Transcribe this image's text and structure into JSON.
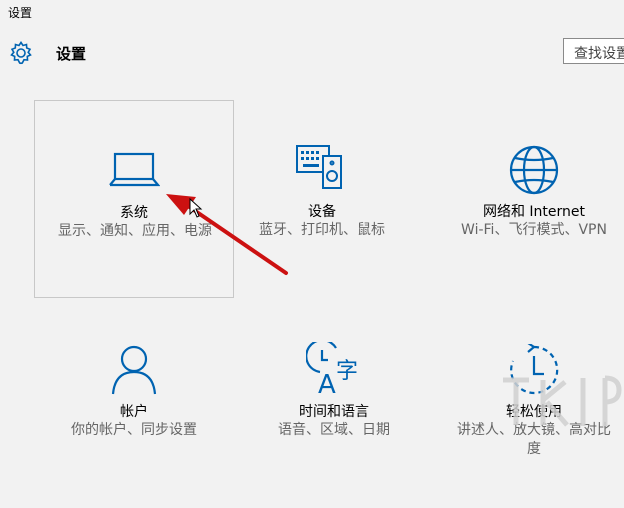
{
  "window": {
    "title": "设置"
  },
  "header": {
    "title": "设置",
    "search_placeholder": "查找设置"
  },
  "colors": {
    "accent": "#0063b1",
    "annotation": "#cc1111",
    "muted": "#666666"
  },
  "categories": [
    {
      "name": "系统",
      "description": "显示、通知、应用、电源",
      "icon": "laptop-icon",
      "selected": true
    },
    {
      "name": "设备",
      "description": "蓝牙、打印机、鼠标",
      "icon": "devices-icon"
    },
    {
      "name": "网络和 Internet",
      "description": "Wi-Fi、飞行模式、VPN",
      "icon": "globe-icon"
    },
    {
      "name": "帐户",
      "description": "你的帐户、同步设置",
      "icon": "person-icon"
    },
    {
      "name": "时间和语言",
      "description": "语音、区域、日期",
      "icon": "time-language-icon"
    },
    {
      "name": "轻松使用",
      "description": "讲述人、放大镜、高对比度",
      "icon": "ease-of-access-icon"
    }
  ]
}
